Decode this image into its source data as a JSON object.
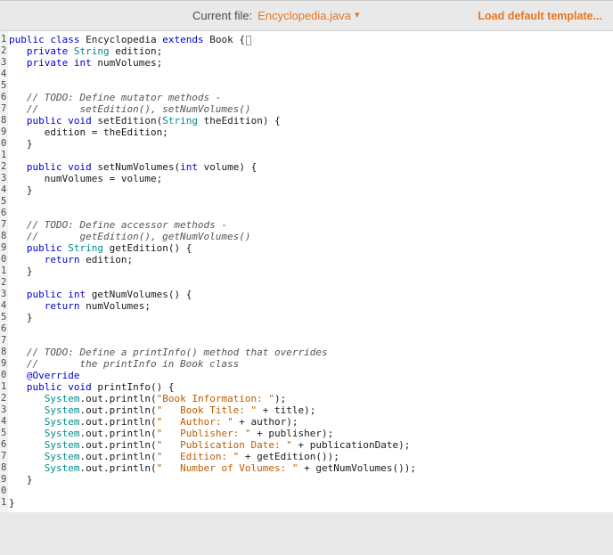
{
  "header": {
    "current_file_label": "Current file:",
    "file_name": "Encyclopedia.java",
    "dropdown_caret": "▾",
    "load_template_label": "Load default template..."
  },
  "editor": {
    "colors": {
      "accent": "#e87722",
      "keyword": "#0000cc",
      "type": "#008b8b",
      "comment": "#555555",
      "string": "#bd5c00",
      "annotation": "#0000cc"
    },
    "lines": [
      {
        "n": "1",
        "t": [
          [
            "k",
            "public"
          ],
          [
            "p",
            " "
          ],
          [
            "k",
            "class"
          ],
          [
            "p",
            " Encyclopedia "
          ],
          [
            "k",
            "extends"
          ],
          [
            "p",
            " Book {"
          ],
          [
            "cur",
            ""
          ]
        ]
      },
      {
        "n": "2",
        "t": [
          [
            "p",
            "   "
          ],
          [
            "k",
            "private"
          ],
          [
            "p",
            " "
          ],
          [
            "t",
            "String"
          ],
          [
            "p",
            " edition;"
          ]
        ]
      },
      {
        "n": "3",
        "t": [
          [
            "p",
            "   "
          ],
          [
            "k",
            "private"
          ],
          [
            "p",
            " "
          ],
          [
            "k",
            "int"
          ],
          [
            "p",
            " numVolumes;"
          ]
        ]
      },
      {
        "n": "4",
        "t": []
      },
      {
        "n": "5",
        "t": []
      },
      {
        "n": "6",
        "t": [
          [
            "c",
            "   // TODO: Define mutator methods -"
          ]
        ]
      },
      {
        "n": "7",
        "t": [
          [
            "c",
            "   //       setEdition(), setNumVolumes()"
          ]
        ]
      },
      {
        "n": "8",
        "t": [
          [
            "p",
            "   "
          ],
          [
            "k",
            "public"
          ],
          [
            "p",
            " "
          ],
          [
            "k",
            "void"
          ],
          [
            "p",
            " setEdition("
          ],
          [
            "t",
            "String"
          ],
          [
            "p",
            " theEdition) {"
          ]
        ]
      },
      {
        "n": "9",
        "t": [
          [
            "p",
            "      edition = theEdition;"
          ]
        ]
      },
      {
        "n": "0",
        "t": [
          [
            "p",
            "   }"
          ]
        ]
      },
      {
        "n": "1",
        "t": []
      },
      {
        "n": "2",
        "t": [
          [
            "p",
            "   "
          ],
          [
            "k",
            "public"
          ],
          [
            "p",
            " "
          ],
          [
            "k",
            "void"
          ],
          [
            "p",
            " setNumVolumes("
          ],
          [
            "k",
            "int"
          ],
          [
            "p",
            " volume) {"
          ]
        ]
      },
      {
        "n": "3",
        "t": [
          [
            "p",
            "      numVolumes = volume;"
          ]
        ]
      },
      {
        "n": "4",
        "t": [
          [
            "p",
            "   }"
          ]
        ]
      },
      {
        "n": "5",
        "t": []
      },
      {
        "n": "6",
        "t": []
      },
      {
        "n": "7",
        "t": [
          [
            "c",
            "   // TODO: Define accessor methods -"
          ]
        ]
      },
      {
        "n": "8",
        "t": [
          [
            "c",
            "   //       getEdition(), getNumVolumes()"
          ]
        ]
      },
      {
        "n": "9",
        "t": [
          [
            "p",
            "   "
          ],
          [
            "k",
            "public"
          ],
          [
            "p",
            " "
          ],
          [
            "t",
            "String"
          ],
          [
            "p",
            " getEdition() {"
          ]
        ]
      },
      {
        "n": "0",
        "t": [
          [
            "p",
            "      "
          ],
          [
            "k",
            "return"
          ],
          [
            "p",
            " edition;"
          ]
        ]
      },
      {
        "n": "1",
        "t": [
          [
            "p",
            "   }"
          ]
        ]
      },
      {
        "n": "2",
        "t": []
      },
      {
        "n": "3",
        "t": [
          [
            "p",
            "   "
          ],
          [
            "k",
            "public"
          ],
          [
            "p",
            " "
          ],
          [
            "k",
            "int"
          ],
          [
            "p",
            " getNumVolumes() {"
          ]
        ]
      },
      {
        "n": "4",
        "t": [
          [
            "p",
            "      "
          ],
          [
            "k",
            "return"
          ],
          [
            "p",
            " numVolumes;"
          ]
        ]
      },
      {
        "n": "5",
        "t": [
          [
            "p",
            "   }"
          ]
        ]
      },
      {
        "n": "6",
        "t": []
      },
      {
        "n": "7",
        "t": []
      },
      {
        "n": "8",
        "t": [
          [
            "c",
            "   // TODO: Define a printInfo() method that overrides"
          ]
        ]
      },
      {
        "n": "9",
        "t": [
          [
            "c",
            "   //       the printInfo in Book class"
          ]
        ]
      },
      {
        "n": "0",
        "t": [
          [
            "p",
            "   "
          ],
          [
            "a",
            "@Override"
          ]
        ]
      },
      {
        "n": "1",
        "t": [
          [
            "p",
            "   "
          ],
          [
            "k",
            "public"
          ],
          [
            "p",
            " "
          ],
          [
            "k",
            "void"
          ],
          [
            "p",
            " printInfo() {"
          ]
        ]
      },
      {
        "n": "2",
        "t": [
          [
            "p",
            "      "
          ],
          [
            "t",
            "System"
          ],
          [
            "p",
            ".out.println("
          ],
          [
            "s",
            "\"Book Information: \""
          ],
          [
            "p",
            ");"
          ]
        ]
      },
      {
        "n": "3",
        "t": [
          [
            "p",
            "      "
          ],
          [
            "t",
            "System"
          ],
          [
            "p",
            ".out.println("
          ],
          [
            "s",
            "\"   Book Title: \""
          ],
          [
            "p",
            " + title);"
          ]
        ]
      },
      {
        "n": "4",
        "t": [
          [
            "p",
            "      "
          ],
          [
            "t",
            "System"
          ],
          [
            "p",
            ".out.println("
          ],
          [
            "s",
            "\"   Author: \""
          ],
          [
            "p",
            " + author);"
          ]
        ]
      },
      {
        "n": "5",
        "t": [
          [
            "p",
            "      "
          ],
          [
            "t",
            "System"
          ],
          [
            "p",
            ".out.println("
          ],
          [
            "s",
            "\"   Publisher: \""
          ],
          [
            "p",
            " + publisher);"
          ]
        ]
      },
      {
        "n": "6",
        "t": [
          [
            "p",
            "      "
          ],
          [
            "t",
            "System"
          ],
          [
            "p",
            ".out.println("
          ],
          [
            "s",
            "\"   Publication Date: \""
          ],
          [
            "p",
            " + publicationDate);"
          ]
        ]
      },
      {
        "n": "7",
        "t": [
          [
            "p",
            "      "
          ],
          [
            "t",
            "System"
          ],
          [
            "p",
            ".out.println("
          ],
          [
            "s",
            "\"   Edition: \""
          ],
          [
            "p",
            " + getEdition());"
          ]
        ]
      },
      {
        "n": "8",
        "t": [
          [
            "p",
            "      "
          ],
          [
            "t",
            "System"
          ],
          [
            "p",
            ".out.println("
          ],
          [
            "s",
            "\"   Number of Volumes: \""
          ],
          [
            "p",
            " + getNumVolumes());"
          ]
        ]
      },
      {
        "n": "9",
        "t": [
          [
            "p",
            "   }"
          ]
        ]
      },
      {
        "n": "0",
        "t": []
      },
      {
        "n": "1",
        "t": [
          [
            "p",
            "}"
          ]
        ]
      }
    ]
  }
}
